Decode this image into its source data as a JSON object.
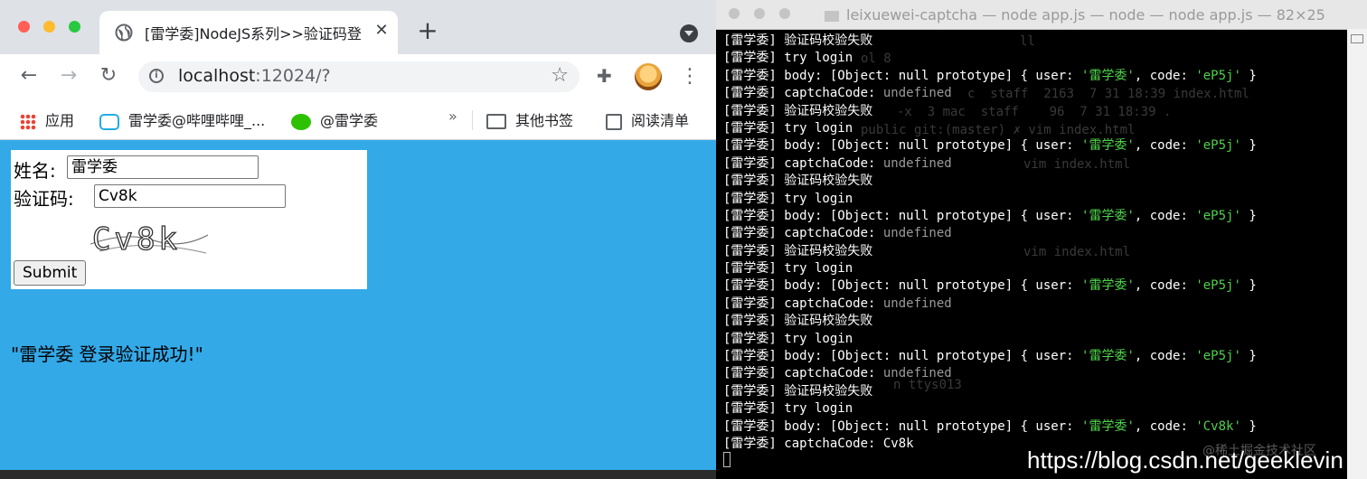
{
  "browser": {
    "tab_title": "[雷学委]NodeJS系列>>验证码登",
    "url_host": "localhost",
    "url_path": ":12024/?",
    "bookmarks": {
      "apps": "应用",
      "bilibili": "雷学委@哔哩哔哩_...",
      "wechat": "@雷学委",
      "more": "»",
      "other": "其他书签",
      "reading_list": "阅读清单"
    }
  },
  "page": {
    "name_label": "姓名:",
    "name_value": "雷学委",
    "captcha_label": "验证码:",
    "captcha_value": "Cv8k",
    "captcha_image_text": "Cv8k",
    "submit_label": "Submit",
    "result_text": "\"雷学委 登录验证成功!\""
  },
  "terminal": {
    "title": "leixuewei-captcha — node app.js — node — node app.js — 82×25",
    "lines": [
      {
        "parts": [
          {
            "t": "[雷学委] 验证码校验失败"
          }
        ]
      },
      {
        "parts": [
          {
            "t": "[雷学委] try login"
          }
        ]
      },
      {
        "parts": [
          {
            "t": "[雷学委] body: [Object: null prototype] { user: "
          },
          {
            "t": "'雷学委'",
            "c": "g"
          },
          {
            "t": ", code: "
          },
          {
            "t": "'eP5j'",
            "c": "g"
          },
          {
            "t": " }"
          }
        ]
      },
      {
        "parts": [
          {
            "t": "[雷学委] captchaCode: "
          },
          {
            "t": "undefined",
            "c": "d"
          }
        ]
      },
      {
        "parts": [
          {
            "t": "[雷学委] 验证码校验失败"
          }
        ]
      },
      {
        "parts": [
          {
            "t": "[雷学委] try login"
          }
        ]
      },
      {
        "parts": [
          {
            "t": "[雷学委] body: [Object: null prototype] { user: "
          },
          {
            "t": "'雷学委'",
            "c": "g"
          },
          {
            "t": ", code: "
          },
          {
            "t": "'eP5j'",
            "c": "g"
          },
          {
            "t": " }"
          }
        ]
      },
      {
        "parts": [
          {
            "t": "[雷学委] captchaCode: "
          },
          {
            "t": "undefined",
            "c": "d"
          }
        ]
      },
      {
        "parts": [
          {
            "t": "[雷学委] 验证码校验失败"
          }
        ]
      },
      {
        "parts": [
          {
            "t": "[雷学委] try login"
          }
        ]
      },
      {
        "parts": [
          {
            "t": "[雷学委] body: [Object: null prototype] { user: "
          },
          {
            "t": "'雷学委'",
            "c": "g"
          },
          {
            "t": ", code: "
          },
          {
            "t": "'eP5j'",
            "c": "g"
          },
          {
            "t": " }"
          }
        ]
      },
      {
        "parts": [
          {
            "t": "[雷学委] captchaCode: "
          },
          {
            "t": "undefined",
            "c": "d"
          }
        ]
      },
      {
        "parts": [
          {
            "t": "[雷学委] 验证码校验失败"
          }
        ]
      },
      {
        "parts": [
          {
            "t": "[雷学委] try login"
          }
        ]
      },
      {
        "parts": [
          {
            "t": "[雷学委] body: [Object: null prototype] { user: "
          },
          {
            "t": "'雷学委'",
            "c": "g"
          },
          {
            "t": ", code: "
          },
          {
            "t": "'eP5j'",
            "c": "g"
          },
          {
            "t": " }"
          }
        ]
      },
      {
        "parts": [
          {
            "t": "[雷学委] captchaCode: "
          },
          {
            "t": "undefined",
            "c": "d"
          }
        ]
      },
      {
        "parts": [
          {
            "t": "[雷学委] 验证码校验失败"
          }
        ]
      },
      {
        "parts": [
          {
            "t": "[雷学委] try login"
          }
        ]
      },
      {
        "parts": [
          {
            "t": "[雷学委] body: [Object: null prototype] { user: "
          },
          {
            "t": "'雷学委'",
            "c": "g"
          },
          {
            "t": ", code: "
          },
          {
            "t": "'eP5j'",
            "c": "g"
          },
          {
            "t": " }"
          }
        ]
      },
      {
        "parts": [
          {
            "t": "[雷学委] captchaCode: "
          },
          {
            "t": "undefined",
            "c": "d"
          }
        ]
      },
      {
        "parts": [
          {
            "t": "[雷学委] 验证码校验失败"
          }
        ]
      },
      {
        "parts": [
          {
            "t": "[雷学委] try login"
          }
        ]
      },
      {
        "parts": [
          {
            "t": "[雷学委] body: [Object: null prototype] { user: "
          },
          {
            "t": "'雷学委'",
            "c": "g"
          },
          {
            "t": ", code: "
          },
          {
            "t": "'Cv8k'",
            "c": "g"
          },
          {
            "t": " }"
          }
        ]
      },
      {
        "parts": [
          {
            "t": "[雷学委] captchaCode: Cv8k"
          }
        ]
      }
    ],
    "ghost_lines": [
      "ll",
      "ol 8",
      "c  staff  2163  7 31 18:39 index.html",
      "-x  3 mac  staff    96  7 31 18:39 .",
      "public git:(master) ✗ vim index.html",
      "vim index.html",
      "vim index.html",
      "n ttys013"
    ],
    "watermark": "https://blog.csdn.net/geeklevin",
    "watermark_faint": "@稀土掘金技术社区"
  },
  "colors": {
    "page_background": "#33a9e8",
    "terminal_green": "#4fd34a",
    "terminal_background": "#000000"
  }
}
